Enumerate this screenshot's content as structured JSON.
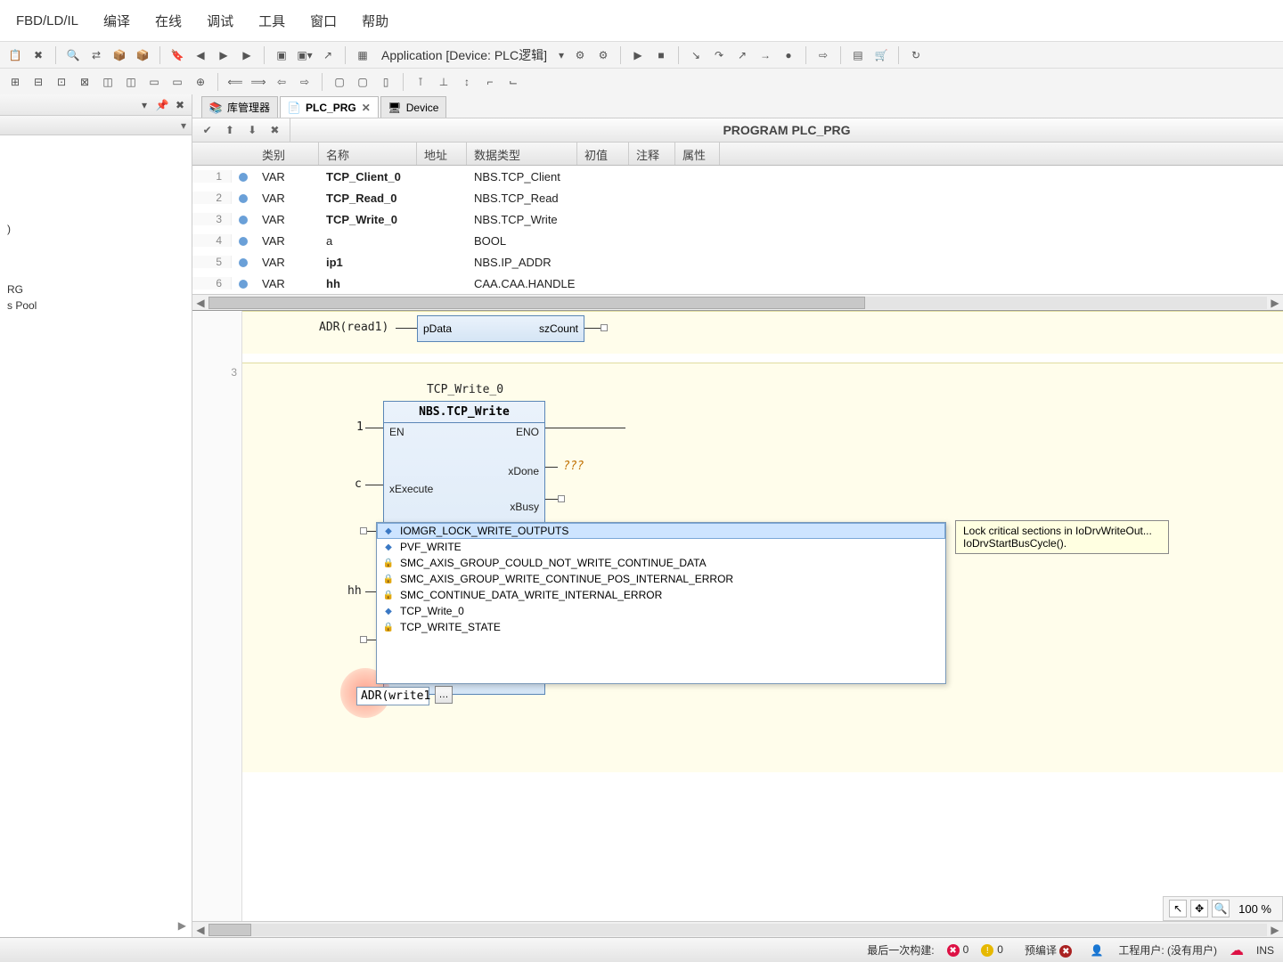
{
  "menu": [
    "FBD/LD/IL",
    "编译",
    "在线",
    "调试",
    "工具",
    "窗口",
    "帮助"
  ],
  "app_dropdown": "Application [Device: PLC逻辑]",
  "sidebar": {
    "items": [
      "RG",
      "s Pool"
    ],
    "text_fragment": ")"
  },
  "tabs": [
    {
      "label": "库管理器",
      "closable": false
    },
    {
      "label": "PLC_PRG",
      "closable": true,
      "active": true
    },
    {
      "label": "Device",
      "closable": false
    }
  ],
  "program_title": "PROGRAM PLC_PRG",
  "var_headers": [
    "类别",
    "名称",
    "地址",
    "数据类型",
    "初值",
    "注释",
    "属性"
  ],
  "variables": [
    {
      "n": 1,
      "kind": "VAR",
      "name": "TCP_Client_0",
      "type": "NBS.TCP_Client",
      "bold": true
    },
    {
      "n": 2,
      "kind": "VAR",
      "name": "TCP_Read_0",
      "type": "NBS.TCP_Read",
      "bold": true
    },
    {
      "n": 3,
      "kind": "VAR",
      "name": "TCP_Write_0",
      "type": "NBS.TCP_Write",
      "bold": true
    },
    {
      "n": 4,
      "kind": "VAR",
      "name": "a",
      "type": "BOOL",
      "bold": false
    },
    {
      "n": 5,
      "kind": "VAR",
      "name": "ip1",
      "type": "NBS.IP_ADDR",
      "bold": true
    },
    {
      "n": 6,
      "kind": "VAR",
      "name": "hh",
      "type": "CAA.CAA.HANDLE",
      "bold": true
    }
  ],
  "network_top": {
    "adr1": "ADR(read1)",
    "inlabel": "pData",
    "outlabel": "szCount"
  },
  "fbd_block": {
    "instance": "TCP_Write_0",
    "type": "NBS.TCP_Write",
    "left_top_num": "1",
    "left_mid": "c",
    "left_bot": "hh",
    "inputs": [
      "EN",
      "xExecute"
    ],
    "outputs": [
      "ENO",
      "xDone",
      "xBusy"
    ],
    "q3": "???"
  },
  "autocomplete": {
    "items": [
      {
        "icon": "blue",
        "label": "IOMGR_LOCK_WRITE_OUTPUTS",
        "selected": true
      },
      {
        "icon": "blue",
        "label": "PVF_WRITE"
      },
      {
        "icon": "yellow",
        "label": "SMC_AXIS_GROUP_COULD_NOT_WRITE_CONTINUE_DATA"
      },
      {
        "icon": "yellow",
        "label": "SMC_AXIS_GROUP_WRITE_CONTINUE_POS_INTERNAL_ERROR"
      },
      {
        "icon": "yellow",
        "label": "SMC_CONTINUE_DATA_WRITE_INTERNAL_ERROR"
      },
      {
        "icon": "blue",
        "label": "TCP_Write_0"
      },
      {
        "icon": "yellow",
        "label": "TCP_WRITE_STATE"
      }
    ],
    "tooltip": "Lock critical sections in IoDrvWriteOut... IoDrvStartBusCycle()."
  },
  "edit_field": "ADR(write1",
  "network_number": "3",
  "zoom": "100 %",
  "status": {
    "build": "最后一次构建:",
    "err_count": "0",
    "warn_count": "0",
    "precompile": "预编译",
    "user": "工程用户: (没有用户)",
    "ins": "INS"
  }
}
